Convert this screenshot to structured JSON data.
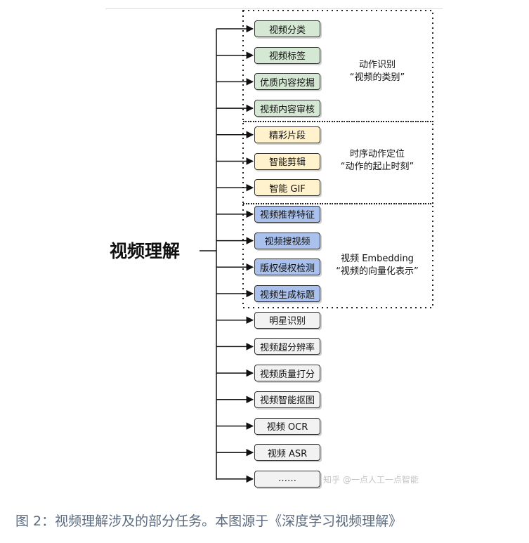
{
  "title": "视频理解",
  "groups": [
    {
      "label_line1": "动作识别",
      "label_line2": "“视频的类别”"
    },
    {
      "label_line1": "时序动作定位",
      "label_line2": "“动作的起止时刻”"
    },
    {
      "label_line1": "视频 Embedding",
      "label_line2": "“视频的向量化表示”"
    }
  ],
  "tasks": [
    {
      "label": "视频分类",
      "group": "green"
    },
    {
      "label": "视频标签",
      "group": "green"
    },
    {
      "label": "优质内容挖掘",
      "group": "green"
    },
    {
      "label": "视频内容审核",
      "group": "green"
    },
    {
      "label": "精彩片段",
      "group": "yellow"
    },
    {
      "label": "智能剪辑",
      "group": "yellow"
    },
    {
      "label": "智能 GIF",
      "group": "yellow"
    },
    {
      "label": "视频推荐特征",
      "group": "blue"
    },
    {
      "label": "视频搜视频",
      "group": "blue"
    },
    {
      "label": "版权侵权检测",
      "group": "blue"
    },
    {
      "label": "视频生成标题",
      "group": "blue"
    },
    {
      "label": "明星识别",
      "group": "gray"
    },
    {
      "label": "视频超分辨率",
      "group": "gray"
    },
    {
      "label": "视频质量打分",
      "group": "gray"
    },
    {
      "label": "视频智能抠图",
      "group": "gray"
    },
    {
      "label": "视频 OCR",
      "group": "gray"
    },
    {
      "label": "视频 ASR",
      "group": "gray"
    },
    {
      "label": "……",
      "group": "gray"
    }
  ],
  "watermark": "知乎 @一点人工一点智能",
  "caption": "图 2：视频理解涉及的部分任务。本图源于《深度学习视频理解》"
}
